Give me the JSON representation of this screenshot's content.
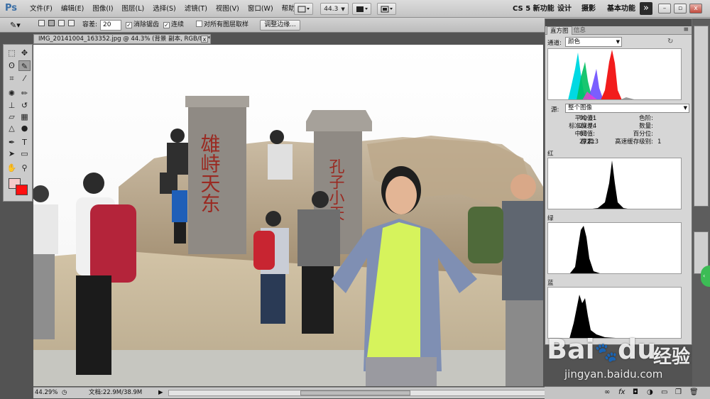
{
  "app": {
    "logo": "Ps"
  },
  "menu": [
    "文件(F)",
    "编辑(E)",
    "图像(I)",
    "图层(L)",
    "选择(S)",
    "滤镜(T)",
    "视图(V)",
    "窗口(W)",
    "帮助(H)"
  ],
  "menubar_controls": {
    "zoom": "44.3"
  },
  "workspaces": [
    "CS 5 新功能",
    "设计",
    "摄影",
    "基本功能"
  ],
  "workspace_more": "»",
  "window_buttons": {
    "minimize": "–",
    "restore": "▫",
    "close": "x"
  },
  "options": {
    "tolerance_label": "容差:",
    "tolerance_value": "20",
    "antialias_label": "消除锯齿",
    "contiguous_label": "连续",
    "sample_all_label": "对所有图层取样",
    "refine_edge_label": "调整边缘..."
  },
  "document": {
    "tab_title": "IMG_20141004_163352.jpg @ 44.3% (背景 副本, RGB/8) *",
    "close": "x",
    "zoom_percent": "44.29%",
    "doc_size": "文档:22.9M/38.9M"
  },
  "histogram_panel": {
    "tabs": [
      "直方图",
      "信息"
    ],
    "channel_label": "通道:",
    "channel_value": "颜色",
    "source_label": "源:",
    "source_value": "整个图像",
    "stats_left": [
      {
        "label": "平均值:",
        "value": "90.01"
      },
      {
        "label": "标准偏差:",
        "value": "27.74"
      },
      {
        "label": "中间值:",
        "value": "83"
      },
      {
        "label": "像素:",
        "value": "27213"
      }
    ],
    "stats_right": [
      {
        "label": "色阶:",
        "value": ""
      },
      {
        "label": "数量:",
        "value": ""
      },
      {
        "label": "百分位:",
        "value": ""
      },
      {
        "label": "高速缓存级别:",
        "value": "1"
      }
    ],
    "channels": [
      "红",
      "绿",
      "蓝"
    ]
  },
  "photo": {
    "stone_left": "雄峙天东",
    "stone_right": "孔子小天"
  },
  "watermark": {
    "name": "Bai",
    "name2": "du",
    "sub": "经验",
    "url": "jingyan.baidu.com"
  },
  "colors": {
    "accent": "#3a6ea5",
    "fg_swatch": "#f5c9c9",
    "bg_swatch": "#ff1010"
  }
}
